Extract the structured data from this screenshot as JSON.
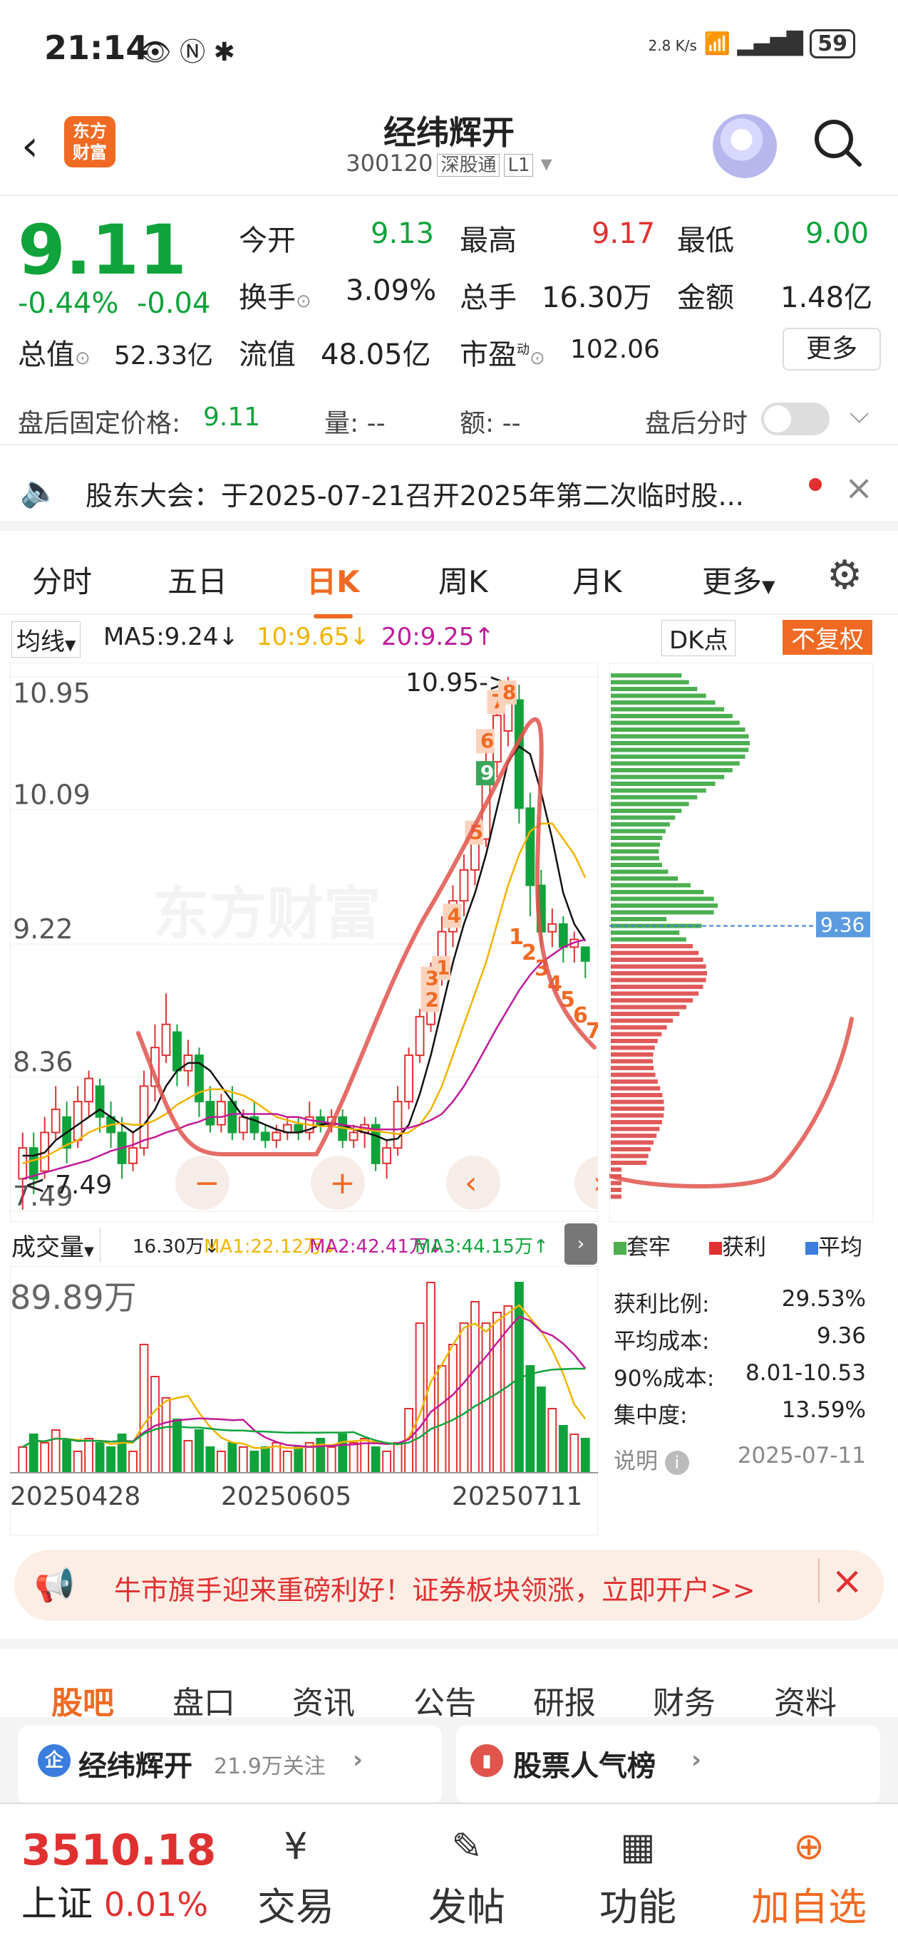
{
  "status_bar": {
    "time": "21:14",
    "net_speed": "2.8 K/s",
    "battery": "59"
  },
  "header": {
    "logo_text": "东方\n财富",
    "title": "经纬辉开",
    "code": "300120",
    "tag1": "深股通",
    "tag2": "L1"
  },
  "quote": {
    "price": "9.11",
    "change_pct": "-0.44%",
    "change": "-0.04",
    "open_label": "今开",
    "open": "9.13",
    "high_label": "最高",
    "high": "9.17",
    "low_label": "最低",
    "low": "9.00",
    "turnover_label": "换手",
    "turnover": "3.09%",
    "volume_label": "总手",
    "volume": "16.30万",
    "amount_label": "金额",
    "amount": "1.48亿",
    "mktcap_label": "总值",
    "mktcap": "52.33亿",
    "float_label": "流值",
    "float": "48.05亿",
    "pe_label": "市盈",
    "pe_sup": "动",
    "pe": "102.06",
    "more": "更多"
  },
  "after_hours": {
    "label": "盘后固定价格:",
    "price": "9.11",
    "vol": "量: --",
    "amt": "额: --",
    "toggle_label": "盘后分时"
  },
  "notice": {
    "text": "股东大会：于2025-07-21召开2025年第二次临时股..."
  },
  "kline_tabs": [
    "分时",
    "五日",
    "日K",
    "周K",
    "月K",
    "更多"
  ],
  "ma_line": {
    "selector": "均线",
    "ma5": "MA5:9.24↓",
    "ma10": "10:9.65↓",
    "ma20": "20:9.25↑",
    "dk": "DK点",
    "fq": "不复权"
  },
  "chart_data": {
    "type": "candlestick",
    "y_ticks": [
      "10.95",
      "10.09",
      "9.22",
      "8.36",
      "7.49"
    ],
    "ylim": [
      7.49,
      10.95
    ],
    "high_marker": "10.95->",
    "low_marker": "<-7.49",
    "cost_marker": "9.36",
    "x_ticks": [
      "20250428",
      "20250605",
      "20250711"
    ],
    "candles": [
      [
        7.7,
        7.9,
        7.5,
        8.0
      ],
      [
        7.9,
        7.7,
        7.6,
        8.0
      ],
      [
        7.75,
        8.0,
        7.7,
        8.1
      ],
      [
        8.0,
        8.15,
        7.95,
        8.3
      ],
      [
        8.1,
        7.9,
        7.8,
        8.2
      ],
      [
        7.95,
        8.2,
        7.9,
        8.3
      ],
      [
        8.2,
        8.35,
        8.1,
        8.4
      ],
      [
        8.3,
        8.1,
        8.0,
        8.35
      ],
      [
        8.1,
        8.0,
        7.9,
        8.2
      ],
      [
        8.0,
        7.8,
        7.7,
        8.1
      ],
      [
        7.8,
        7.9,
        7.75,
        8.0
      ],
      [
        7.9,
        8.3,
        7.85,
        8.4
      ],
      [
        8.3,
        8.55,
        8.2,
        8.7
      ],
      [
        8.5,
        8.7,
        8.45,
        8.9
      ],
      [
        8.65,
        8.4,
        8.3,
        8.7
      ],
      [
        8.4,
        8.5,
        8.3,
        8.6
      ],
      [
        8.5,
        8.2,
        8.1,
        8.55
      ],
      [
        8.2,
        8.05,
        8.0,
        8.3
      ],
      [
        8.05,
        8.2,
        8.0,
        8.25
      ],
      [
        8.2,
        8.0,
        7.95,
        8.3
      ],
      [
        8.0,
        8.1,
        7.95,
        8.15
      ],
      [
        8.1,
        8.0,
        7.95,
        8.2
      ],
      [
        8.0,
        7.95,
        7.9,
        8.05
      ],
      [
        7.95,
        8.0,
        7.9,
        8.05
      ],
      [
        8.0,
        8.05,
        7.95,
        8.1
      ],
      [
        8.05,
        8.0,
        7.95,
        8.1
      ],
      [
        8.0,
        8.1,
        7.95,
        8.2
      ],
      [
        8.1,
        8.05,
        8.0,
        8.15
      ],
      [
        8.05,
        8.1,
        8.0,
        8.15
      ],
      [
        8.1,
        7.95,
        7.9,
        8.15
      ],
      [
        7.95,
        8.0,
        7.9,
        8.05
      ],
      [
        8.0,
        8.05,
        7.9,
        8.1
      ],
      [
        8.05,
        7.8,
        7.75,
        8.1
      ],
      [
        7.8,
        7.9,
        7.7,
        7.95
      ],
      [
        7.9,
        8.2,
        7.85,
        8.3
      ],
      [
        8.2,
        8.5,
        8.15,
        8.55
      ],
      [
        8.5,
        8.75,
        8.45,
        8.8
      ],
      [
        8.7,
        9.0,
        8.65,
        9.1
      ],
      [
        9.0,
        9.3,
        8.95,
        9.4
      ],
      [
        9.3,
        9.5,
        9.2,
        9.6
      ],
      [
        9.5,
        9.7,
        9.4,
        9.8
      ],
      [
        9.7,
        9.9,
        9.6,
        10.0
      ],
      [
        9.9,
        10.4,
        9.85,
        10.5
      ],
      [
        10.4,
        10.7,
        10.3,
        10.8
      ],
      [
        10.6,
        10.9,
        10.5,
        10.95
      ],
      [
        10.8,
        10.1,
        10.0,
        10.9
      ],
      [
        10.1,
        9.6,
        9.4,
        10.2
      ],
      [
        9.6,
        9.3,
        9.2,
        9.7
      ],
      [
        9.3,
        9.35,
        9.2,
        9.45
      ],
      [
        9.35,
        9.2,
        9.1,
        9.4
      ],
      [
        9.2,
        9.25,
        9.1,
        9.3
      ],
      [
        9.2,
        9.11,
        9.0,
        9.17
      ]
    ],
    "ma5": [
      7.85,
      7.85,
      7.87,
      7.95,
      8.0,
      8.05,
      8.1,
      8.15,
      8.1,
      8.05,
      8.0,
      8.05,
      8.15,
      8.3,
      8.4,
      8.45,
      8.45,
      8.4,
      8.3,
      8.2,
      8.1,
      8.08,
      8.05,
      8.02,
      8.0,
      8.0,
      8.02,
      8.05,
      8.06,
      8.05,
      8.02,
      8.0,
      7.98,
      7.95,
      7.96,
      8.05,
      8.25,
      8.5,
      8.8,
      9.1,
      9.35,
      9.55,
      9.8,
      10.1,
      10.4,
      10.5,
      10.45,
      10.2,
      9.9,
      9.55,
      9.35,
      9.24
    ],
    "ma10": [
      7.8,
      7.82,
      7.84,
      7.88,
      7.92,
      7.95,
      8.0,
      8.03,
      8.05,
      8.06,
      8.05,
      8.05,
      8.08,
      8.12,
      8.18,
      8.22,
      8.26,
      8.28,
      8.28,
      8.26,
      8.24,
      8.2,
      8.15,
      8.1,
      8.08,
      8.06,
      8.05,
      8.04,
      8.04,
      8.03,
      8.02,
      8.02,
      8.01,
      8.0,
      7.99,
      8.0,
      8.05,
      8.15,
      8.3,
      8.5,
      8.7,
      8.9,
      9.1,
      9.35,
      9.6,
      9.8,
      9.95,
      10.0,
      10.0,
      9.9,
      9.8,
      9.65
    ],
    "ma20": [
      7.7,
      7.72,
      7.74,
      7.76,
      7.78,
      7.8,
      7.82,
      7.85,
      7.88,
      7.9,
      7.92,
      7.95,
      7.97,
      8.0,
      8.02,
      8.05,
      8.07,
      8.1,
      8.1,
      8.12,
      8.12,
      8.12,
      8.12,
      8.12,
      8.1,
      8.1,
      8.08,
      8.07,
      8.06,
      8.05,
      8.04,
      8.03,
      8.02,
      8.02,
      8.02,
      8.03,
      8.05,
      8.08,
      8.12,
      8.2,
      8.3,
      8.42,
      8.55,
      8.68,
      8.8,
      8.92,
      9.02,
      9.1,
      9.15,
      9.2,
      9.23,
      9.25
    ],
    "markers": [
      "1",
      "2",
      "3",
      "4",
      "5",
      "6",
      "7",
      "8",
      "9"
    ]
  },
  "volume": {
    "selector": "成交量",
    "vol": "16.30万↓",
    "ma1": "MA1:22.12万↓",
    "ma2": "MA2:42.41万↓",
    "ma3": "MA3:44.15万↑",
    "max_label": "89.89万",
    "bars": [
      12,
      18,
      14,
      20,
      15,
      10,
      16,
      14,
      12,
      18,
      10,
      60,
      45,
      35,
      25,
      15,
      20,
      12,
      10,
      14,
      12,
      10,
      12,
      14,
      10,
      12,
      14,
      16,
      12,
      18,
      14,
      16,
      12,
      10,
      14,
      30,
      70,
      89,
      50,
      60,
      70,
      80,
      70,
      75,
      78,
      89,
      50,
      40,
      30,
      22,
      18,
      16
    ]
  },
  "dist_info": {
    "legend_trap": "套牢",
    "legend_profit": "获利",
    "legend_avg": "平均",
    "profit_ratio_label": "获利比例:",
    "profit_ratio": "29.53%",
    "avg_cost_label": "平均成本:",
    "avg_cost": "9.36",
    "cost90_label": "90%成本:",
    "cost90": "8.01-10.53",
    "concentration_label": "集中度:",
    "concentration": "13.59%",
    "note_label": "说明",
    "date": "2025-07-11"
  },
  "banner": {
    "text": "牛市旗手迎来重磅利好！证券板块领涨，立即开户>>"
  },
  "bottom_tabs": [
    "股吧",
    "盘口",
    "资讯",
    "公告",
    "研报",
    "财务",
    "资料"
  ],
  "cards": {
    "left_title": "经纬辉开",
    "left_sub": "21.9万关注",
    "right_title": "股票人气榜"
  },
  "bottom_nav": {
    "index_value": "3510.18",
    "index_name": "上证",
    "index_change": "0.01%",
    "trade": "交易",
    "post": "发帖",
    "func": "功能",
    "add": "加自选"
  },
  "colors": {
    "up": "#e03131",
    "down": "#10a33b",
    "accent": "#f06a23",
    "ma5": "#111111",
    "ma10": "#f0b400",
    "ma20": "#c01a9a"
  }
}
